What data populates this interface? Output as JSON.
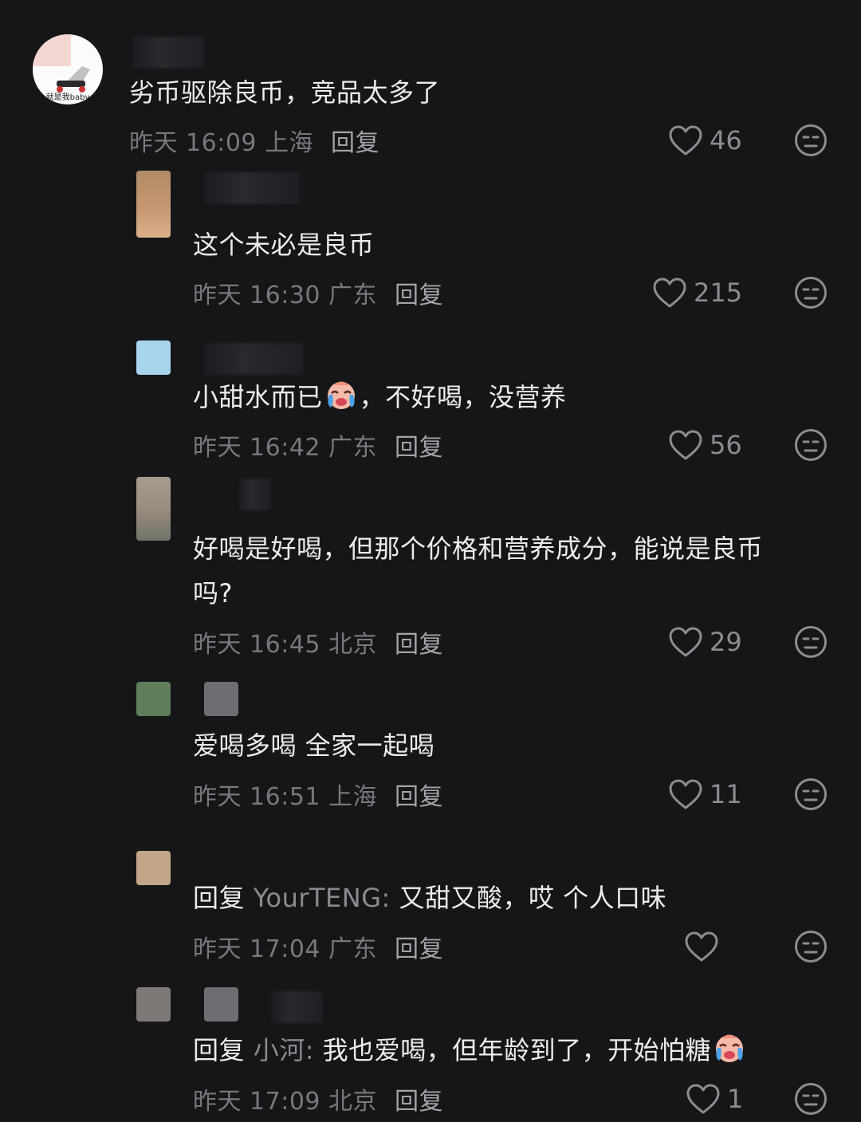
{
  "comments": [
    {
      "text": "劣币驱除良币，竞品太多了",
      "time": "昨天 16:09 上海",
      "reply": "回复",
      "likes": "46",
      "avatar_label": "就是我baby"
    },
    {
      "text": "这个未必是良币",
      "time": "昨天 16:30 广东",
      "reply": "回复",
      "likes": "215"
    },
    {
      "text_a": "小甜水而已",
      "text_b": "，不好喝，没营养",
      "time": "昨天 16:42 广东",
      "reply": "回复",
      "likes": "56"
    },
    {
      "text": "好喝是好喝，但那个价格和营养成分，能说是良币",
      "text_line2": "吗?",
      "time": "昨天 16:45 北京",
      "reply": "回复",
      "likes": "29"
    },
    {
      "text": "爱喝多喝 全家一起喝",
      "time": "昨天 16:51 上海",
      "reply": "回复",
      "likes": "11"
    },
    {
      "reply_prefix": "回复",
      "quoted_user": "YourTENG:",
      "text": " 又甜又酸，哎 个人口味",
      "time": "昨天 17:04 广东",
      "reply": "回复",
      "likes": ""
    },
    {
      "reply_prefix": "回复",
      "quoted_user": "小河:",
      "text": " 我也爱喝，但年龄到了，开始怕糖",
      "time": "昨天 17:09 北京",
      "reply": "回复",
      "likes": "1"
    }
  ],
  "colors": {
    "background": "#161619",
    "text": "#ececee",
    "meta": "#77777c",
    "icon": "#8c8c91"
  },
  "icons": {
    "like": "heart-icon",
    "dislike": "unamused-face-icon",
    "emoji": "crying-face-emoji"
  }
}
